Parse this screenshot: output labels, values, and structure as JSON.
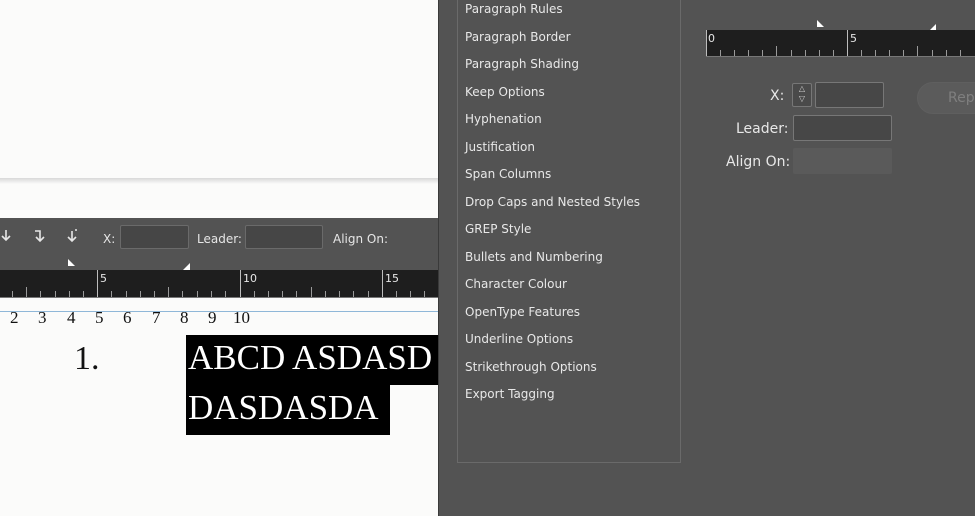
{
  "toolbar": {
    "x_label": "X:",
    "leader_label": "Leader:",
    "align_on_label": "Align On:",
    "x_value": "",
    "leader_value": ""
  },
  "doc_ruler": {
    "labels": [
      "5",
      "10",
      "15"
    ]
  },
  "doc_numbers": [
    "2",
    "3",
    "4",
    "5",
    "6",
    "7",
    "8",
    "9",
    "10"
  ],
  "document": {
    "list_number": "1.",
    "line1": "ABCD ASDASD",
    "line2": "DASDASDA"
  },
  "categories": [
    "Paragraph Rules",
    "Paragraph Border",
    "Paragraph Shading",
    "Keep Options",
    "Hyphenation",
    "Justification",
    "Span Columns",
    "Drop Caps and Nested Styles",
    "GREP Style",
    "Bullets and Numbering",
    "Character Colour",
    "OpenType Features",
    "Underline Options",
    "Strikethrough Options",
    "Export Tagging"
  ],
  "dialog_ruler": {
    "labels": [
      "0",
      "5"
    ]
  },
  "dialog": {
    "x_label": "X:",
    "leader_label": "Leader:",
    "align_on_label": "Align On:",
    "repeat_label": "Rep",
    "x_value": "",
    "leader_value": ""
  }
}
